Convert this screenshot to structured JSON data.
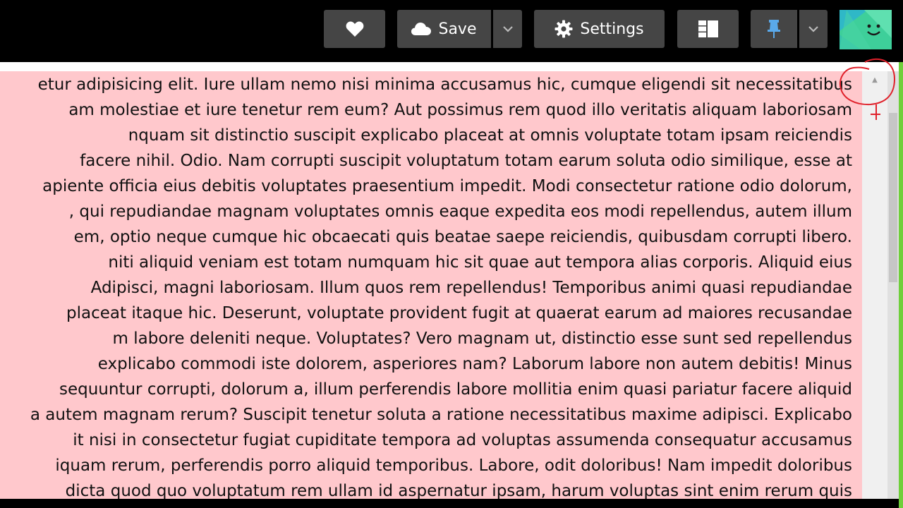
{
  "toolbar": {
    "heart_icon": "heart-icon",
    "save_label": "Save",
    "save_icon": "cloud-icon",
    "save_dropdown_icon": "chevron-down-icon",
    "settings_label": "Settings",
    "settings_icon": "gear-icon",
    "layout_icon": "layout-icon",
    "pin_icon": "pin-icon",
    "pin_dropdown_icon": "chevron-down-icon",
    "button_bg": "#454545"
  },
  "avatar": {
    "icon": "smiley-avatar-icon",
    "color": "#3ecf9a"
  },
  "content": {
    "background": "#ffc8cc",
    "lines": [
      "etur adipisicing elit. Iure ullam nemo nisi minima accusamus hic, cumque eligendi sit necessitatibus",
      "am molestiae et iure tenetur rem eum? Aut possimus rem quod illo veritatis aliquam laboriosam",
      "nquam sit distinctio suscipit explicabo placeat at omnis voluptate totam ipsam reiciendis",
      "facere nihil. Odio. Nam corrupti suscipit voluptatum totam earum soluta odio similique, esse at",
      "apiente officia eius debitis voluptates praesentium impedit. Modi consectetur ratione odio dolorum,",
      ", qui repudiandae magnam voluptates omnis eaque expedita eos modi repellendus, autem illum",
      "em, optio neque cumque hic obcaecati quis beatae saepe reiciendis, quibusdam corrupti libero.",
      "niti aliquid veniam est totam numquam hic sit quae aut tempora alias corporis. Aliquid eius",
      "Adipisci, magni laboriosam. Illum quos rem repellendus! Temporibus animi quasi repudiandae",
      "placeat itaque hic. Deserunt, voluptate provident fugit at quaerat earum ad maiores recusandae",
      "m labore deleniti neque. Voluptates? Vero magnam ut, distinctio esse sunt sed repellendus",
      "explicabo commodi iste dolorem, asperiores nam? Laborum labore non autem debitis! Minus",
      "sequuntur corrupti, dolorum a, illum perferendis labore mollitia enim quasi pariatur facere aliquid",
      "a autem magnam rerum? Suscipit tenetur soluta a ratione necessitatibus maxime adipisci. Explicabo",
      "it nisi in consectetur fugiat cupiditate tempora ad voluptas assumenda consequatur accusamus",
      "iquam rerum, perferendis porro aliquid temporibus. Labore, odit doloribus! Nam impedit doloribus",
      "dicta quod quo voluptatum rem ullam id aspernatur ipsam, harum voluptas sint enim rerum quis"
    ]
  },
  "scrollbar": {
    "up_arrow": "▲",
    "annotation_color": "#e0202a"
  }
}
